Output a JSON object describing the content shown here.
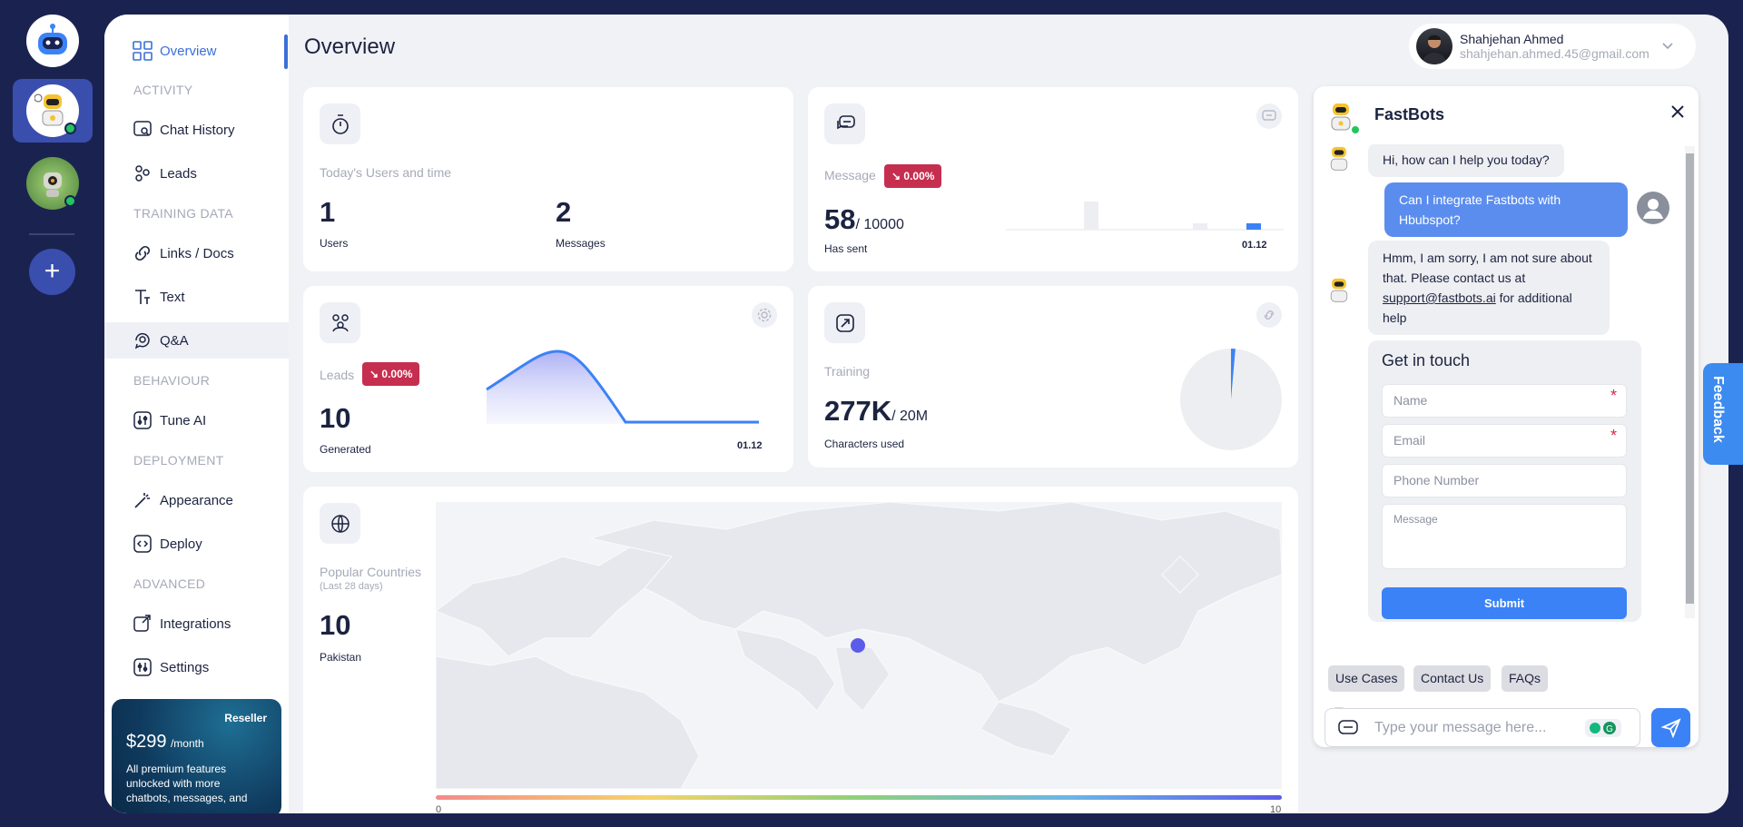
{
  "colors": {
    "accent": "#3b6fd6",
    "badge_red": "#c62e4f",
    "chat_blue": "#5b8def",
    "submit": "#3b82f6",
    "bg_dark": "#1a2350"
  },
  "rail": {
    "add_label": "+"
  },
  "sidebar": {
    "sections": {
      "activity": "ACTIVITY",
      "training": "TRAINING DATA",
      "behaviour": "BEHAVIOUR",
      "deployment": "DEPLOYMENT",
      "advanced": "ADVANCED"
    },
    "items": {
      "overview": "Overview",
      "chat_history": "Chat History",
      "leads": "Leads",
      "links_docs": "Links / Docs",
      "text": "Text",
      "qa": "Q&A",
      "tune_ai": "Tune AI",
      "appearance": "Appearance",
      "deploy": "Deploy",
      "integrations": "Integrations",
      "settings": "Settings"
    },
    "promo": {
      "tag": "Reseller",
      "price": "$299",
      "per": "/month",
      "desc": "All premium features unlocked with more chatbots, messages, and"
    }
  },
  "header": {
    "title": "Overview",
    "user_name": "Shahjehan Ahmed",
    "user_email": "shahjehan.ahmed.45@gmail.com"
  },
  "cards": {
    "users": {
      "label": "Today's Users and time",
      "users_value": "1",
      "users_label": "Users",
      "messages_value": "2",
      "messages_label": "Messages"
    },
    "message": {
      "label": "Message",
      "badge": "↘ 0.00%",
      "value": "58",
      "total": "/ 10000",
      "sub": "Has sent",
      "date": "01.12"
    },
    "leads": {
      "label": "Leads",
      "badge": "↘ 0.00%",
      "value": "10",
      "sub": "Generated",
      "date": "01.12"
    },
    "training": {
      "label": "Training",
      "value": "277K",
      "total": "/ 20M",
      "sub": "Characters used",
      "fraction_used": 0.0139
    },
    "countries": {
      "label": "Popular Countries",
      "sublabel": "(Last 28 days)",
      "value": "10",
      "sub": "Pakistan",
      "scale_min": "0",
      "scale_max": "10"
    }
  },
  "chat": {
    "title": "FastBots",
    "messages": [
      {
        "text": "Hi, how can I help you today?"
      },
      {
        "text": "Can I integrate Fastbots with Hbubspot?"
      },
      {
        "text_a": "Hmm, I am sorry, I am not sure about that. Please contact us at ",
        "link": "support@fastbots.ai",
        "text_b": " for additional help"
      }
    ],
    "form": {
      "title": "Get in touch",
      "name": "Name",
      "email": "Email",
      "phone": "Phone Number",
      "message": "Message",
      "submit": "Submit"
    },
    "chips": [
      "Use Cases",
      "Contact Us",
      "FAQs"
    ],
    "input_placeholder": "Type your message here..."
  },
  "feedback": "Feedback"
}
